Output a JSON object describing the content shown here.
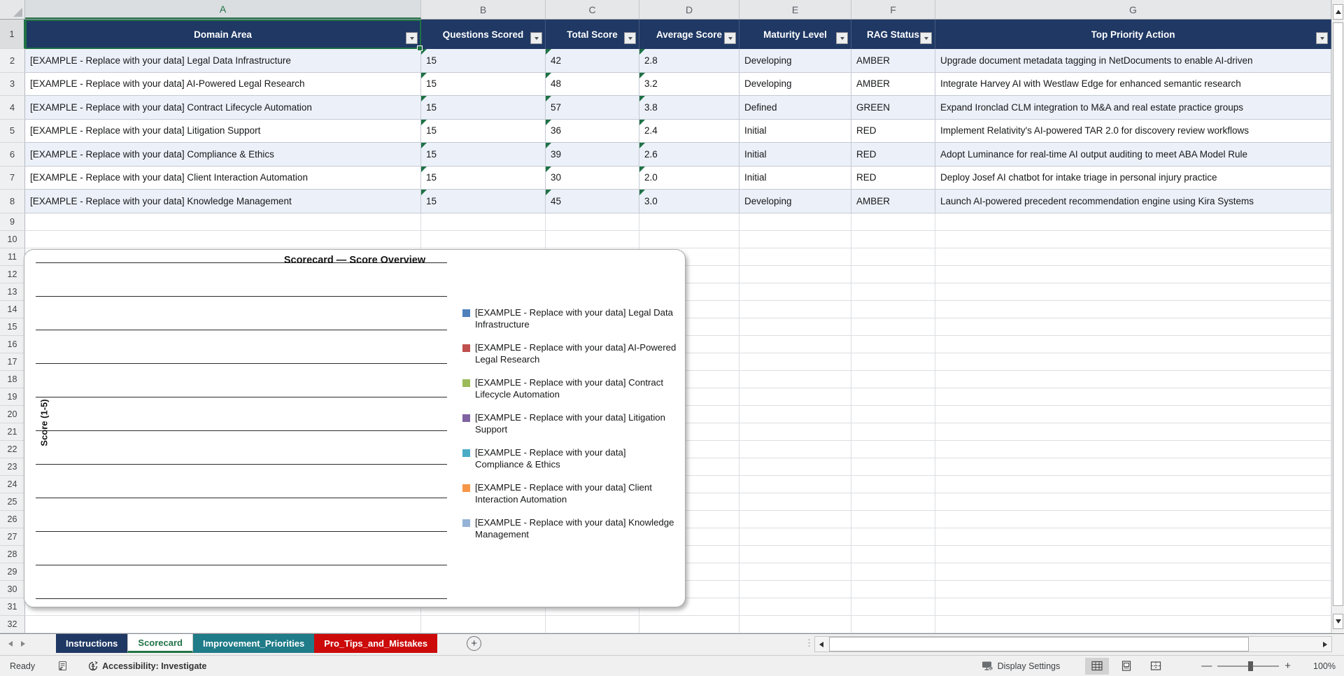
{
  "sheet": {
    "selected_cell": "A1",
    "columns": [
      {
        "letter": "A",
        "header": "Domain Area"
      },
      {
        "letter": "B",
        "header": "Questions Scored"
      },
      {
        "letter": "C",
        "header": "Total Score"
      },
      {
        "letter": "D",
        "header": "Average Score"
      },
      {
        "letter": "E",
        "header": "Maturity Level"
      },
      {
        "letter": "F",
        "header": "RAG Status"
      },
      {
        "letter": "G",
        "header": "Top Priority Action"
      }
    ],
    "header_row_number": "1",
    "rows": [
      {
        "n": "2",
        "domain_area": "[EXAMPLE - Replace with your data] Legal Data Infrastructure",
        "questions_scored": "15",
        "total_score": "42",
        "average_score": "2.8",
        "maturity_level": "Developing",
        "rag_status": "AMBER",
        "top_priority_action": "Upgrade document metadata tagging in NetDocuments to enable AI-driven"
      },
      {
        "n": "3",
        "domain_area": "[EXAMPLE - Replace with your data] AI-Powered Legal Research",
        "questions_scored": "15",
        "total_score": "48",
        "average_score": "3.2",
        "maturity_level": "Developing",
        "rag_status": "AMBER",
        "top_priority_action": "Integrate Harvey AI with Westlaw Edge for enhanced semantic research"
      },
      {
        "n": "4",
        "domain_area": "[EXAMPLE - Replace with your data] Contract Lifecycle Automation",
        "questions_scored": "15",
        "total_score": "57",
        "average_score": "3.8",
        "maturity_level": "Defined",
        "rag_status": "GREEN",
        "top_priority_action": "Expand Ironclad CLM integration to M&A and real estate practice groups"
      },
      {
        "n": "5",
        "domain_area": "[EXAMPLE - Replace with your data] Litigation Support",
        "questions_scored": "15",
        "total_score": "36",
        "average_score": "2.4",
        "maturity_level": "Initial",
        "rag_status": "RED",
        "top_priority_action": "Implement Relativity's AI-powered TAR 2.0 for discovery review workflows"
      },
      {
        "n": "6",
        "domain_area": "[EXAMPLE - Replace with your data] Compliance & Ethics",
        "questions_scored": "15",
        "total_score": "39",
        "average_score": "2.6",
        "maturity_level": "Initial",
        "rag_status": "RED",
        "top_priority_action": "Adopt Luminance for real-time AI output auditing to meet ABA Model Rule"
      },
      {
        "n": "7",
        "domain_area": "[EXAMPLE - Replace with your data] Client Interaction Automation",
        "questions_scored": "15",
        "total_score": "30",
        "average_score": "2.0",
        "maturity_level": "Initial",
        "rag_status": "RED",
        "top_priority_action": "Deploy Josef AI chatbot for intake triage in personal injury practice"
      },
      {
        "n": "8",
        "domain_area": "[EXAMPLE - Replace with your data] Knowledge Management",
        "questions_scored": "15",
        "total_score": "45",
        "average_score": "3.0",
        "maturity_level": "Developing",
        "rag_status": "AMBER",
        "top_priority_action": "Launch AI-powered precedent recommendation engine using Kira Systems"
      }
    ],
    "empty_row_numbers": [
      "9",
      "10",
      "11",
      "12",
      "13",
      "14",
      "15",
      "16",
      "17",
      "18",
      "19",
      "20",
      "21",
      "22",
      "23",
      "24",
      "25",
      "26",
      "27",
      "28",
      "29",
      "30",
      "31",
      "32"
    ]
  },
  "chart": {
    "title": "Scorecard — Score Overview",
    "y_axis_label": "Score (1-5)",
    "legend": [
      {
        "name": "[EXAMPLE - Replace with your data] Legal Data Infrastructure",
        "color": "#4F81BD"
      },
      {
        "name": "[EXAMPLE - Replace with your data] AI-Powered Legal Research",
        "color": "#C0504D"
      },
      {
        "name": "[EXAMPLE - Replace with your data] Contract Lifecycle Automation",
        "color": "#9BBB59"
      },
      {
        "name": "[EXAMPLE - Replace with your data] Litigation Support",
        "color": "#8064A2"
      },
      {
        "name": "[EXAMPLE - Replace with your data] Compliance & Ethics",
        "color": "#4BACC6"
      },
      {
        "name": "[EXAMPLE - Replace with your data] Client Interaction Automation",
        "color": "#F79646"
      },
      {
        "name": "[EXAMPLE - Replace with your data] Knowledge Management",
        "color": "#95B3D7"
      }
    ]
  },
  "chart_data": {
    "type": "column",
    "title": "Scorecard — Score Overview",
    "ylabel": "Score (1-5)",
    "ylim": [
      0,
      5
    ],
    "gridlines": true,
    "legend_position": "right",
    "plot_area_empty": true,
    "series": [
      {
        "name": "[EXAMPLE - Replace with your data] Legal Data Infrastructure",
        "color": "#4F81BD",
        "values": []
      },
      {
        "name": "[EXAMPLE - Replace with your data] AI-Powered Legal Research",
        "color": "#C0504D",
        "values": []
      },
      {
        "name": "[EXAMPLE - Replace with your data] Contract Lifecycle Automation",
        "color": "#9BBB59",
        "values": []
      },
      {
        "name": "[EXAMPLE - Replace with your data] Litigation Support",
        "color": "#8064A2",
        "values": []
      },
      {
        "name": "[EXAMPLE - Replace with your data] Compliance & Ethics",
        "color": "#4BACC6",
        "values": []
      },
      {
        "name": "[EXAMPLE - Replace with your data] Client Interaction Automation",
        "color": "#F79646",
        "values": []
      },
      {
        "name": "[EXAMPLE - Replace with your data] Knowledge Management",
        "color": "#95B3D7",
        "values": []
      }
    ]
  },
  "sheet_tabs": {
    "tabs": [
      {
        "label": "Instructions",
        "color": "#1F3864",
        "active": false
      },
      {
        "label": "Scorecard",
        "color": "#217346",
        "active": true
      },
      {
        "label": "Improvement_Priorities",
        "color": "#1F7C88",
        "active": false
      },
      {
        "label": "Pro_Tips_and_Mistakes",
        "color": "#CC0A0A",
        "active": false
      }
    ],
    "add_sheet_label": "+"
  },
  "status_bar": {
    "ready_label": "Ready",
    "accessibility_label": "Accessibility: Investigate",
    "display_settings_label": "Display Settings",
    "zoom_level": "100%"
  }
}
